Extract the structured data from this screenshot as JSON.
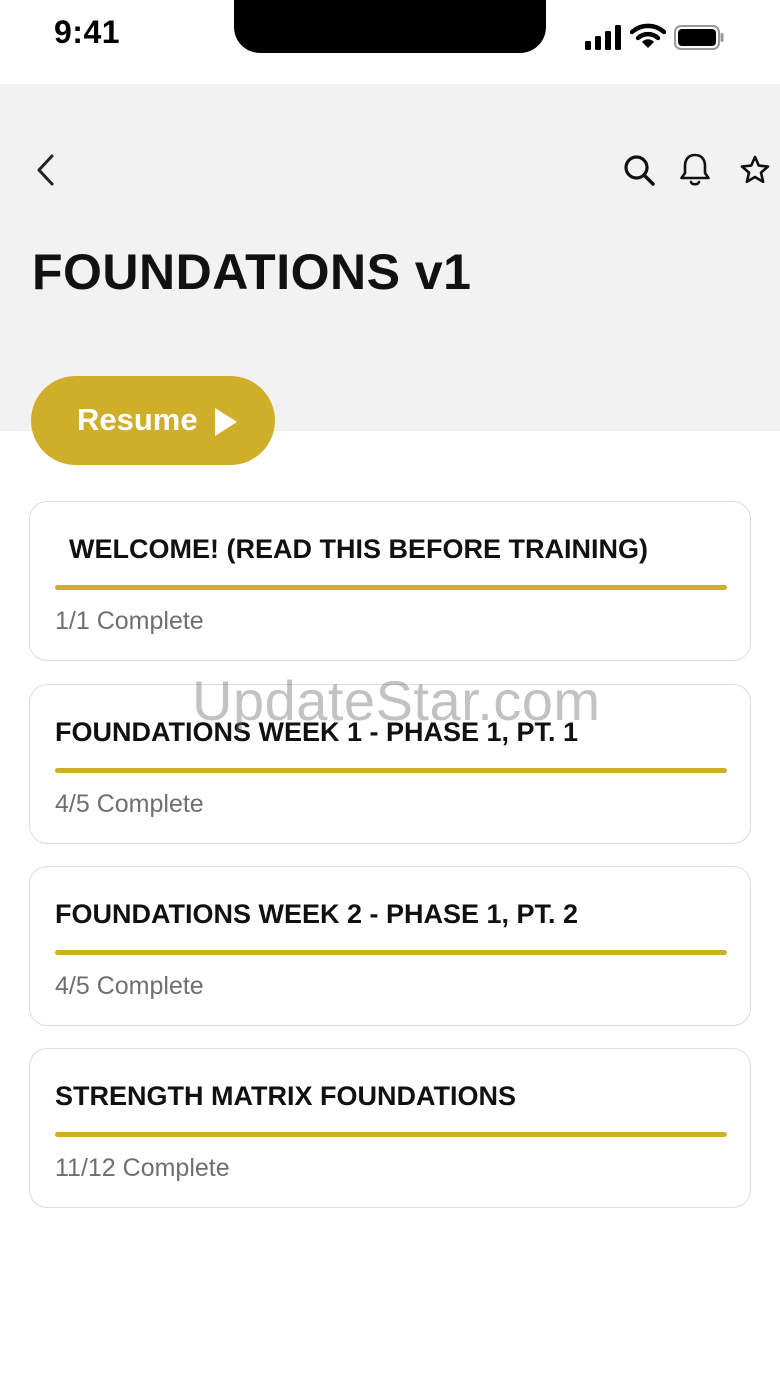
{
  "status_bar": {
    "time": "9:41"
  },
  "header": {
    "title": "FOUNDATIONS v1"
  },
  "resume": {
    "label": "Resume"
  },
  "sections": [
    {
      "title": "WELCOME! (READ THIS BEFORE TRAINING)",
      "status": "1/1 Complete",
      "progress": 1.0
    },
    {
      "title": "FOUNDATIONS WEEK 1 - PHASE 1, PT. 1",
      "status": "4/5 Complete",
      "progress": 1.0
    },
    {
      "title": "FOUNDATIONS WEEK 2 - PHASE 1, PT. 2",
      "status": "4/5 Complete",
      "progress": 1.0
    },
    {
      "title": "STRENGTH MATRIX FOUNDATIONS",
      "status": "11/12 Complete",
      "progress": 1.0
    }
  ],
  "watermark": "UpdateStar.com",
  "colors": {
    "accent": "#cfae2a",
    "header_bg": "#f2f2f2",
    "muted_text": "#6f6f6f"
  },
  "icons": [
    "back-icon",
    "search-icon",
    "bell-icon",
    "star-icon",
    "play-icon",
    "signal-icon",
    "wifi-icon",
    "battery-icon"
  ]
}
